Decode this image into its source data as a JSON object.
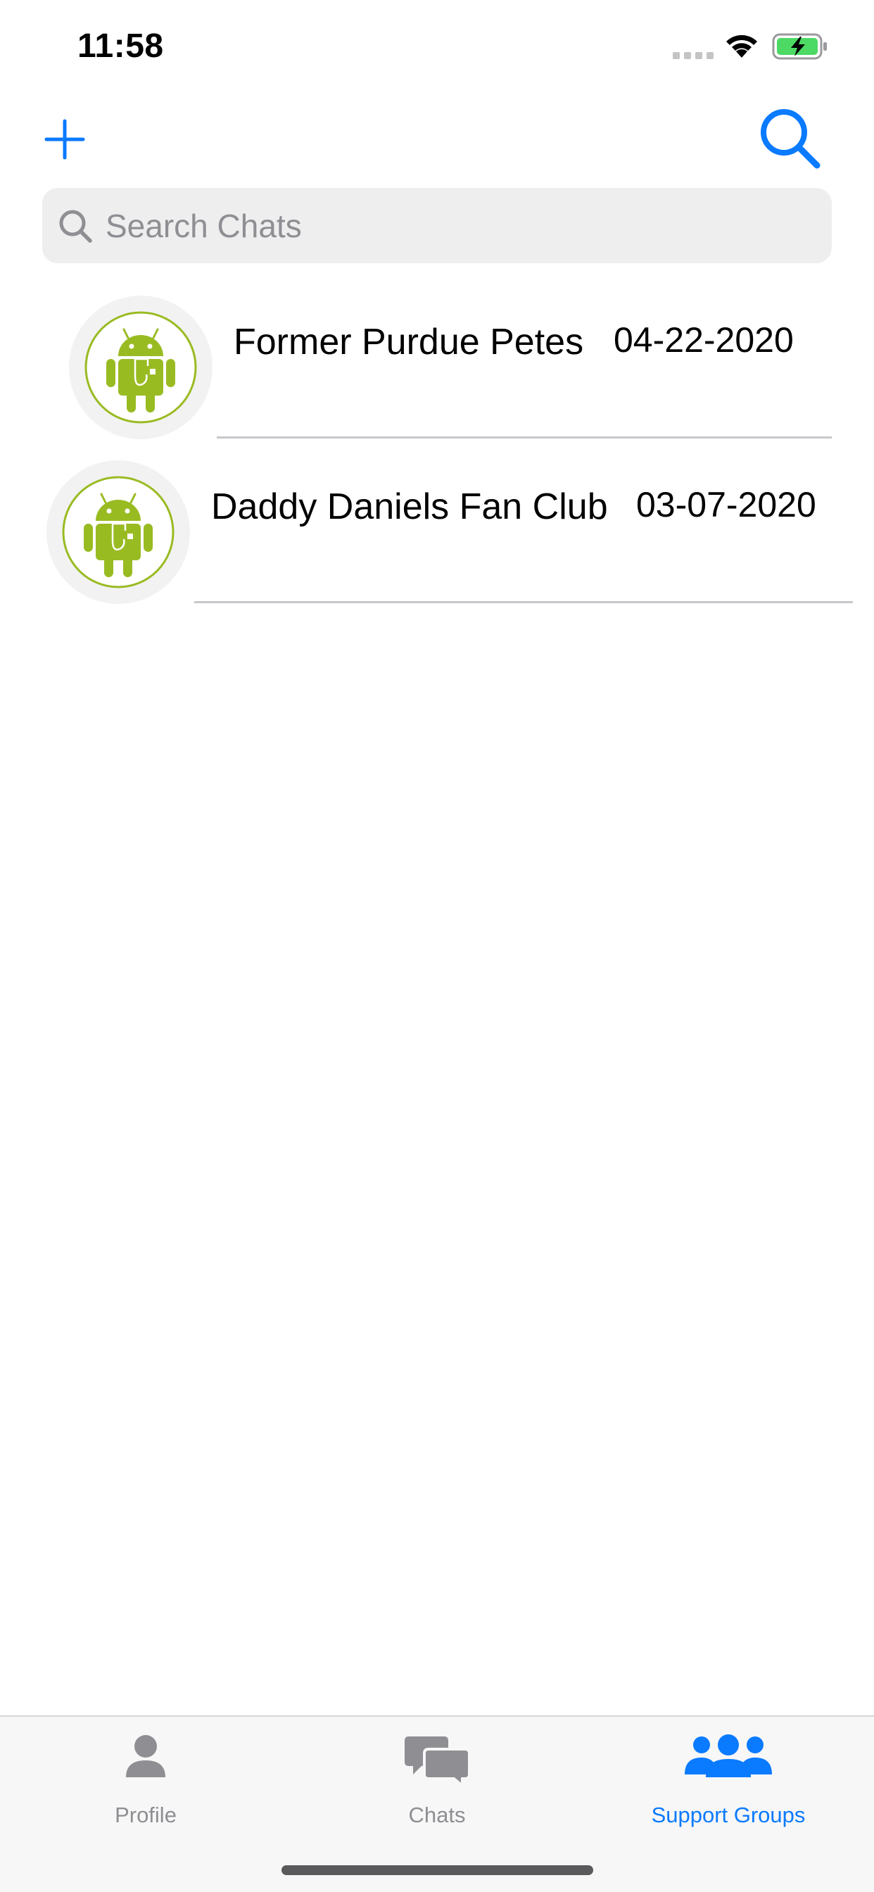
{
  "status_bar": {
    "time": "11:58"
  },
  "nav": {
    "add_icon": "plus-icon",
    "search_icon": "search-icon"
  },
  "search": {
    "placeholder": "Search Chats",
    "value": ""
  },
  "chats": [
    {
      "title": "Former Purdue Petes",
      "date": "04-22-2020",
      "avatar": "android-avatar"
    },
    {
      "title": "Daddy Daniels Fan Club",
      "date": "03-07-2020",
      "avatar": "android-avatar"
    }
  ],
  "tabs": [
    {
      "label": "Profile",
      "icon": "person-icon",
      "active": false
    },
    {
      "label": "Chats",
      "icon": "chat-bubbles-icon",
      "active": false
    },
    {
      "label": "Support Groups",
      "icon": "group-icon",
      "active": true
    }
  ],
  "colors": {
    "accent": "#0a7aff",
    "inactive": "#8e8e93",
    "android_green": "#99bb22",
    "battery_green": "#4cd964"
  }
}
